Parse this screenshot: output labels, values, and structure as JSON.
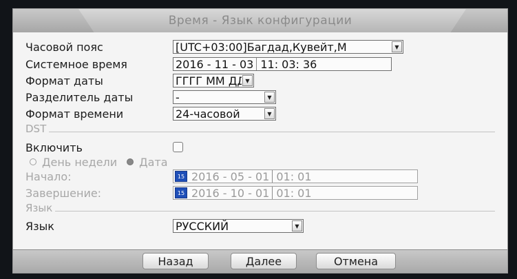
{
  "dialog": {
    "title": "Время - Язык конфигурации"
  },
  "fields": {
    "timezone": {
      "label": "Часовой пояс",
      "value": "[UTC+03:00]Багдад,Кувейт,М"
    },
    "system_time": {
      "label": "Системное время",
      "date": "2016 - 11 - 03",
      "time": "11: 03: 36"
    },
    "date_format": {
      "label": "Формат даты",
      "value": "ГГГГ ММ ДД"
    },
    "date_separator": {
      "label": "Разделитель даты",
      "value": "-"
    },
    "time_format": {
      "label": "Формат времени",
      "value": "24-часовой"
    }
  },
  "dst": {
    "section_title": "DST",
    "enable_label": "Включить",
    "enabled": false,
    "mode_week_label": "День недели",
    "mode_date_label": "Дата",
    "selected_mode": "Дата",
    "start_label": "Начало:",
    "start_date": "2016 - 05 - 01",
    "start_time": "01: 01",
    "end_label": "Завершение:",
    "end_date": "2016 - 10 - 01",
    "end_time": "01: 01",
    "calendar_icon_text": "15"
  },
  "language": {
    "section_title": "Язык",
    "label": "Язык",
    "value": "РУССКИЙ"
  },
  "buttons": {
    "back": "Назад",
    "next": "Далее",
    "cancel": "Отмена"
  },
  "icons": {
    "dropdown": "chevron-down-icon",
    "calendar": "calendar-icon"
  }
}
